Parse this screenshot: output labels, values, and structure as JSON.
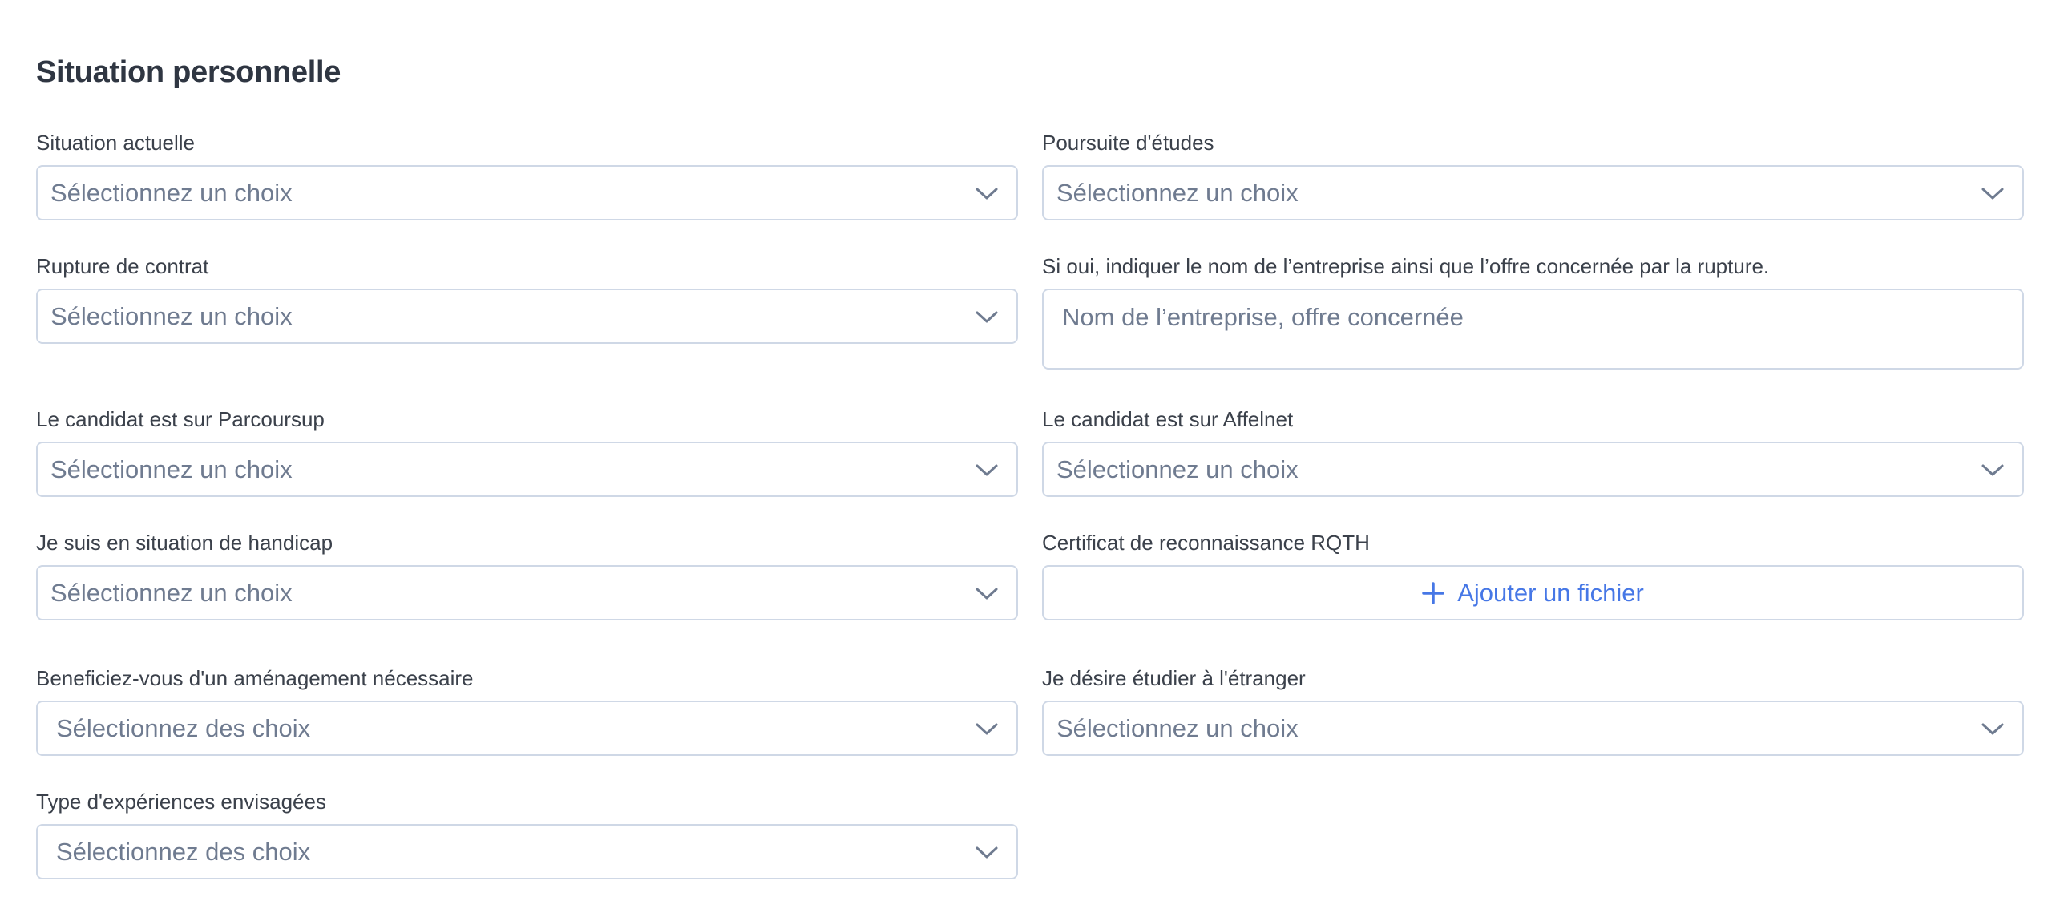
{
  "section": {
    "title": "Situation personnelle"
  },
  "fields": {
    "situation_actuelle": {
      "label": "Situation actuelle",
      "value": "Sélectionnez un choix"
    },
    "poursuite_etudes": {
      "label": "Poursuite d'études",
      "value": "Sélectionnez un choix"
    },
    "rupture_contrat": {
      "label": "Rupture de contrat",
      "value": "Sélectionnez un choix"
    },
    "entreprise_rupture": {
      "label": "Si oui, indiquer le nom de l’entreprise ainsi que l’offre concernée par la rupture.",
      "placeholder": "Nom de l’entreprise, offre concernée"
    },
    "parcoursup": {
      "label": "Le candidat est sur Parcoursup",
      "value": "Sélectionnez un choix"
    },
    "affelnet": {
      "label": "Le candidat est sur Affelnet",
      "value": "Sélectionnez un choix"
    },
    "handicap": {
      "label": "Je suis en situation de handicap",
      "value": "Sélectionnez un choix"
    },
    "rqth": {
      "label": "Certificat de reconnaissance RQTH",
      "button_label": "Ajouter un fichier"
    },
    "amenagement": {
      "label": "Beneficiez-vous d'un aménagement nécessaire",
      "value": "Sélectionnez des choix"
    },
    "etranger": {
      "label": "Je désire étudier à l'étranger",
      "value": "Sélectionnez un choix"
    },
    "experiences": {
      "label": "Type d'expériences envisagées",
      "value": "Sélectionnez des choix"
    }
  },
  "icons": {
    "select_arrow": "chevron-down-icon",
    "upload": "plus-icon"
  },
  "colors": {
    "border": "#cfd8e6",
    "placeholder": "#6f7b90",
    "accent": "#4677e6",
    "text": "#2d3440"
  }
}
